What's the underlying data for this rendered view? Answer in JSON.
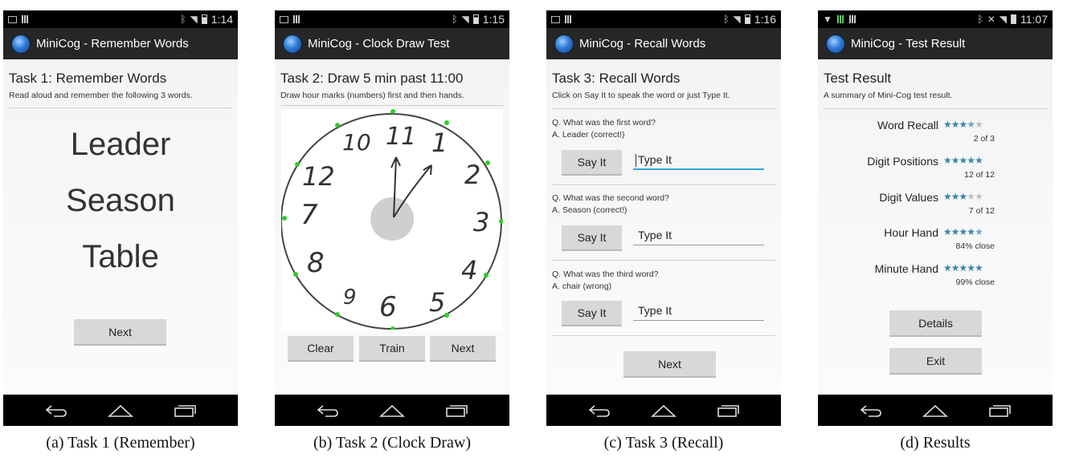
{
  "app_name": "MiniCog",
  "panels": [
    {
      "status": {
        "time": "1:14"
      },
      "title": "MiniCog - Remember Words",
      "task_title": "Task 1: Remember Words",
      "task_sub": "Read aloud and remember the following 3 words.",
      "words": [
        "Leader",
        "Season",
        "Table"
      ],
      "next_label": "Next",
      "caption": "(a) Task 1 (Remember)"
    },
    {
      "status": {
        "time": "1:15"
      },
      "title": "MiniCog - Clock Draw Test",
      "task_title": "Task 2: Draw 5 min past 11:00",
      "task_sub": "Draw hour marks (numbers) first and then hands.",
      "clock_numbers": [
        "11",
        "1",
        "2",
        "3",
        "4",
        "5",
        "6",
        "9",
        "8",
        "7",
        "12",
        "10"
      ],
      "buttons": {
        "clear": "Clear",
        "train": "Train",
        "next": "Next"
      },
      "caption": "(b) Task 2 (Clock Draw)"
    },
    {
      "status": {
        "time": "1:16"
      },
      "title": "MiniCog - Recall Words",
      "task_title": "Task 3: Recall Words",
      "task_sub": "Click on Say It to speak the word or just Type It.",
      "questions": [
        {
          "q": "Q. What was the first word?",
          "a": "A. Leader (correct!)",
          "say": "Say It",
          "type": "Type It"
        },
        {
          "q": "Q. What was the second word?",
          "a": "A. Season (correct!)",
          "say": "Say It",
          "type": "Type It"
        },
        {
          "q": "Q. What was the third word?",
          "a": "A. chair (wrong)",
          "say": "Say It",
          "type": "Type It"
        }
      ],
      "next_label": "Next",
      "caption": "(c) Task 3 (Recall)"
    },
    {
      "status": {
        "time": "11:07"
      },
      "title": "MiniCog - Test Result",
      "task_title": "Test Result",
      "task_sub": "A summary of Mini-Cog test result.",
      "results": [
        {
          "label": "Word Recall",
          "stars": 3.5,
          "detail": "2 of 3"
        },
        {
          "label": "Digit Positions",
          "stars": 5,
          "detail": "12 of 12"
        },
        {
          "label": "Digit Values",
          "stars": 3,
          "detail": "7 of 12"
        },
        {
          "label": "Hour Hand",
          "stars": 4.5,
          "detail": "84% close"
        },
        {
          "label": "Minute Hand",
          "stars": 5,
          "detail": "99% close"
        }
      ],
      "details_label": "Details",
      "exit_label": "Exit",
      "caption": "(d) Results"
    }
  ],
  "colors": {
    "actionbar": "#262626",
    "accent_focus": "#33a6d8",
    "star_on": "#3a84a8",
    "star_off": "#bdbdbd",
    "button": "#d8d8d8"
  },
  "icons": {
    "back": "back-icon",
    "home": "home-icon",
    "recents": "recents-icon",
    "app": "minicog-globe-icon"
  }
}
